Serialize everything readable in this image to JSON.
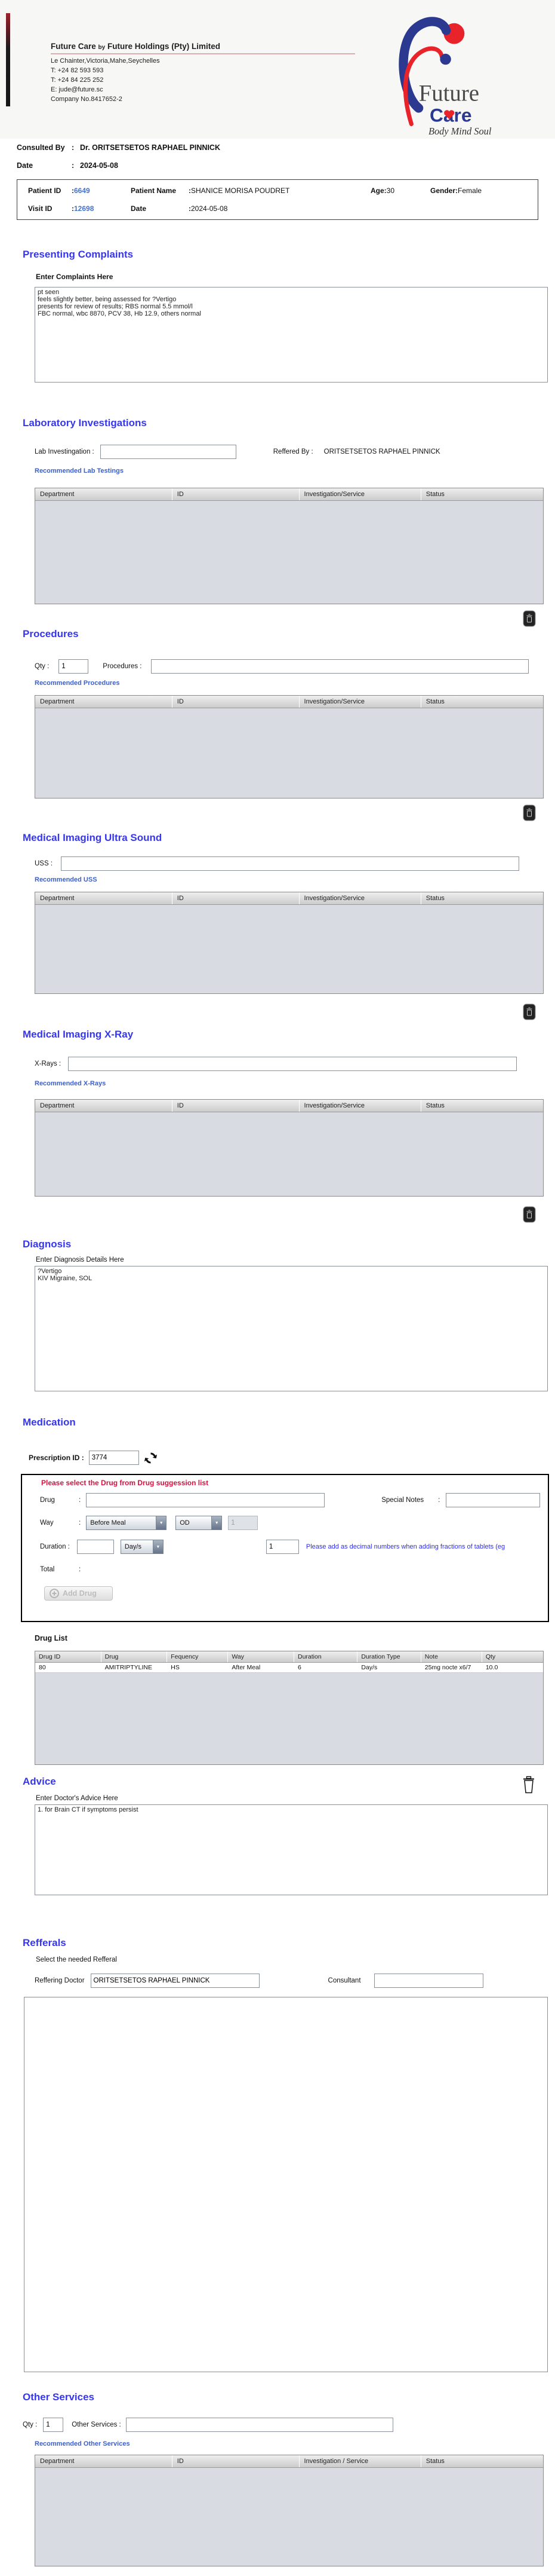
{
  "punct": {
    "colon": ":"
  },
  "icons": {
    "dropdown_arrow": "▼"
  },
  "header": {
    "company_1": "Future Care ",
    "company_by": "by",
    "company_2": " Future Holdings (Pty) Limited",
    "address": "Le Chainter,Victoria,Mahe,Seychelles",
    "phone1": "T: +24  82 593 593",
    "phone2": "T: +24  84 225 252",
    "email": "E: jude@future.sc",
    "company_no": "Company No.8417652-2",
    "logo": {
      "word1": "Future",
      "word2": "Care",
      "tagline": "Body Mind Soul",
      "blue": "#2b3990",
      "red": "#e8232a"
    }
  },
  "consult": {
    "consulted_by_label": "Consulted By",
    "consulted_by_value": "Dr.  ORITSETSETOS RAPHAEL PINNICK",
    "date_label": "Date",
    "date_value": "2024-05-08"
  },
  "patient": {
    "patient_id_label": "Patient ID",
    "patient_id": "6649",
    "name_label": "Patient Name",
    "name": "SHANICE MORISA POUDRET",
    "age_label": "Age",
    "age": "30",
    "gender_label": "Gender",
    "gender": "Female",
    "visit_id_label": "Visit ID",
    "visit_id": "12698",
    "visit_date_label": "Date",
    "visit_date": "2024-05-08"
  },
  "complaints": {
    "title": "Presenting Complaints",
    "label": "Enter Complaints Here",
    "text": "pt seen\nfeels slightly better, being assessed for ?Vertigo\npresents for review of results; RBS normal 5.5 mmol/l\nFBC normal, wbc 8870, PCV 38, Hb 12.9, others normal"
  },
  "service_headers": [
    "Department",
    "ID",
    "Investigation/Service",
    "Status"
  ],
  "other_service_headers": [
    "Department",
    "ID",
    "Investigation / Service",
    "Status"
  ],
  "lab": {
    "title": "Laboratory  Investigations",
    "input_label": "Lab Investingation :",
    "referred_label": "Reffered By :",
    "referred_value": "ORITSETSETOS RAPHAEL PINNICK",
    "link": "Recommended Lab Testings"
  },
  "procedures": {
    "title": "Procedures",
    "qty_label": "Qty :",
    "qty_value": "1",
    "input_label": "Procedures :",
    "link": "Recommended Procedures"
  },
  "uss": {
    "title": "Medical Imaging Ultra Sound",
    "input_label": "USS :",
    "link": "Recommended USS"
  },
  "xray": {
    "title": "Medical Imaging X-Ray",
    "input_label": "X-Rays :",
    "link": "Recommended X-Rays"
  },
  "diagnosis": {
    "title": "Diagnosis",
    "label": "Enter Diagnosis Details Here",
    "text": "?Vertigo\nKIV Migraine, SOL"
  },
  "medication": {
    "title": "Medication",
    "prescription_label": "Prescription ID :",
    "prescription_id": "3774",
    "warning": "Please select the Drug from Drug suggession list",
    "drug_label": "Drug",
    "special_notes_label": "Special Notes",
    "way_label": "Way",
    "way_select1": "Before Meal",
    "way_select2": "OD",
    "way_qty": "1",
    "duration_label": "Duration :",
    "duration_select": "Day/s",
    "qty_value": "1",
    "hint": "Please add as decimal numbers when adding fractions of tablets (eg",
    "total_label": "Total",
    "add_drug_label": "Add Drug",
    "drug_list_label": "Drug List",
    "table": {
      "headers": [
        "Drug ID",
        "Drug",
        "Fequency",
        "Way",
        "Duration",
        "Duration Type",
        "Note",
        "Qty"
      ],
      "row": [
        "80",
        "AMITRIPTYLINE",
        "HS",
        "After Meal",
        "6",
        "Day/s",
        "25mg nocte x6/7",
        "10.0"
      ]
    }
  },
  "advice": {
    "title": "Advice",
    "label": "Enter Doctor's Advice Here",
    "text": "1. for Brain CT if symptoms persist"
  },
  "referrals": {
    "title": "Refferals",
    "subtitle": "Select the needed Refferal",
    "doctor_label": "Reffering Doctor",
    "doctor_value": "ORITSETSETOS RAPHAEL PINNICK",
    "consultant_label": "Consultant"
  },
  "other": {
    "title": "Other Services",
    "qty_label": "Qty :",
    "qty_value": "1",
    "input_label": "Other Services :",
    "link": "Recommended Other Services"
  }
}
